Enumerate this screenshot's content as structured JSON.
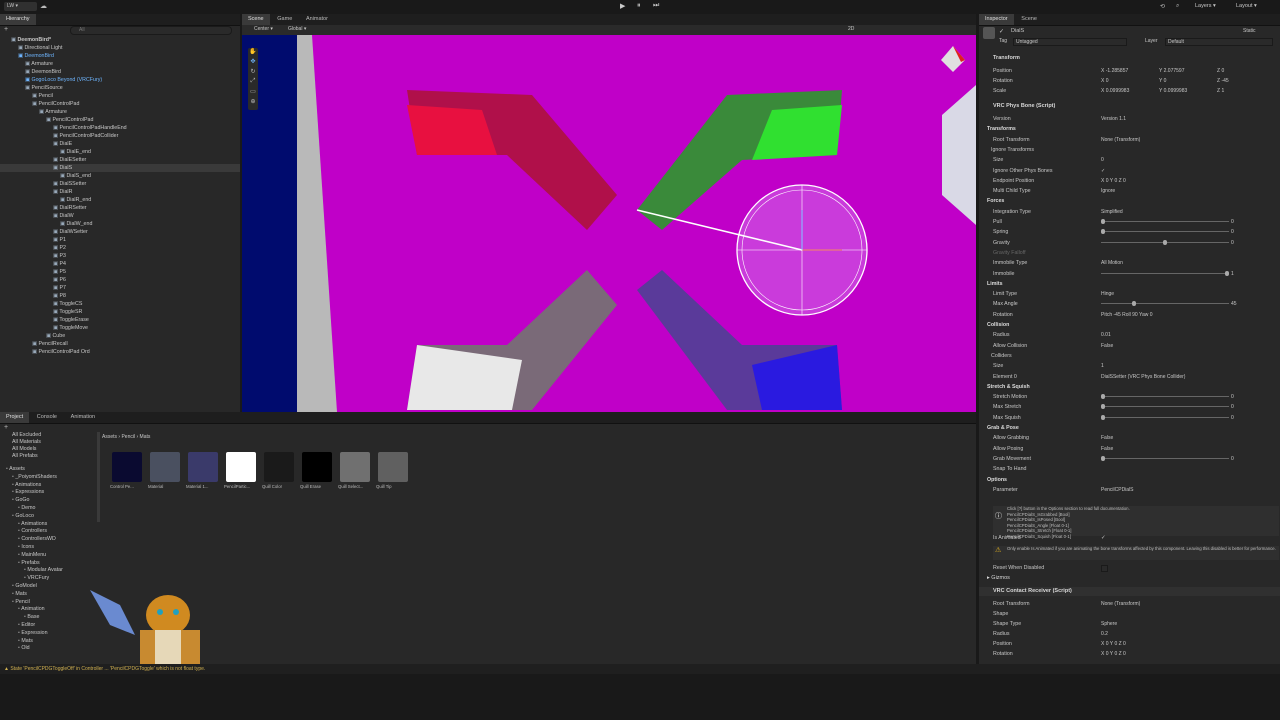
{
  "toolbar": {
    "account": "LW",
    "right_labels": [
      "Layers",
      "Layout"
    ],
    "play": "▶",
    "pause": "⏸",
    "step": "⏭"
  },
  "hierarchy": {
    "tab": "Hierarchy",
    "search_placeholder": "All",
    "items": [
      {
        "label": "DeemonBird*",
        "depth": 1,
        "style": "bold"
      },
      {
        "label": "Directional Light",
        "depth": 2,
        "style": "normal"
      },
      {
        "label": "DeemonBird",
        "depth": 2,
        "style": "blue"
      },
      {
        "label": "Armature",
        "depth": 3,
        "style": "normal"
      },
      {
        "label": "DeemonBird",
        "depth": 3,
        "style": "normal"
      },
      {
        "label": "GogoLoco Beyond (VRCFury)",
        "depth": 3,
        "style": "blue"
      },
      {
        "label": "PencilSource",
        "depth": 3,
        "style": "normal"
      },
      {
        "label": "Pencil",
        "depth": 4,
        "style": "normal"
      },
      {
        "label": "PencilControlPad",
        "depth": 4,
        "style": "normal"
      },
      {
        "label": "Armature",
        "depth": 5,
        "style": "normal"
      },
      {
        "label": "PencilControlPad",
        "depth": 6,
        "style": "normal"
      },
      {
        "label": "PencilControlPadHandleEnd",
        "depth": 7,
        "style": "normal"
      },
      {
        "label": "PencilControlPadCollider",
        "depth": 7,
        "style": "normal"
      },
      {
        "label": "DialE",
        "depth": 7,
        "style": "normal"
      },
      {
        "label": "DialE_end",
        "depth": 8,
        "style": "normal"
      },
      {
        "label": "DialESetter",
        "depth": 7,
        "style": "normal"
      },
      {
        "label": "DialS",
        "depth": 7,
        "style": "selected"
      },
      {
        "label": "DialS_end",
        "depth": 8,
        "style": "normal"
      },
      {
        "label": "DialSSetter",
        "depth": 7,
        "style": "normal"
      },
      {
        "label": "DialR",
        "depth": 7,
        "style": "normal"
      },
      {
        "label": "DialR_end",
        "depth": 8,
        "style": "normal"
      },
      {
        "label": "DialRSetter",
        "depth": 7,
        "style": "normal"
      },
      {
        "label": "DialW",
        "depth": 7,
        "style": "normal"
      },
      {
        "label": "DialW_end",
        "depth": 8,
        "style": "normal"
      },
      {
        "label": "DialWSetter",
        "depth": 7,
        "style": "normal"
      },
      {
        "label": "P1",
        "depth": 7,
        "style": "normal"
      },
      {
        "label": "P2",
        "depth": 7,
        "style": "normal"
      },
      {
        "label": "P3",
        "depth": 7,
        "style": "normal"
      },
      {
        "label": "P4",
        "depth": 7,
        "style": "normal"
      },
      {
        "label": "P5",
        "depth": 7,
        "style": "normal"
      },
      {
        "label": "P6",
        "depth": 7,
        "style": "normal"
      },
      {
        "label": "P7",
        "depth": 7,
        "style": "normal"
      },
      {
        "label": "P8",
        "depth": 7,
        "style": "normal"
      },
      {
        "label": "ToggleCS",
        "depth": 7,
        "style": "normal"
      },
      {
        "label": "ToggleSR",
        "depth": 7,
        "style": "normal"
      },
      {
        "label": "ToggleErase",
        "depth": 7,
        "style": "normal"
      },
      {
        "label": "ToggleMove",
        "depth": 7,
        "style": "normal"
      },
      {
        "label": "Cube",
        "depth": 6,
        "style": "normal"
      },
      {
        "label": "PencilRecall",
        "depth": 4,
        "style": "normal"
      },
      {
        "label": "PencilControlPad Ord",
        "depth": 4,
        "style": "normal"
      }
    ]
  },
  "scene": {
    "tabs": [
      "Scene",
      "Game",
      "Animator"
    ],
    "pivot": "Center",
    "space": "Global",
    "mode_2d": "2D"
  },
  "project": {
    "tabs": [
      "Project",
      "Console",
      "Animation"
    ],
    "breadcrumb": [
      "Assets",
      "Pencil",
      "Mats"
    ],
    "favorites": [
      "All Excluded",
      "All Materials",
      "All Models",
      "All Prefabs"
    ],
    "tree": [
      {
        "label": "Assets",
        "depth": 0
      },
      {
        "label": "_PoiyomiShaders",
        "depth": 1
      },
      {
        "label": "Animations",
        "depth": 1
      },
      {
        "label": "Expressions",
        "depth": 1
      },
      {
        "label": "GoGo",
        "depth": 1
      },
      {
        "label": "Demo",
        "depth": 2
      },
      {
        "label": "GoLoco",
        "depth": 1
      },
      {
        "label": "Animations",
        "depth": 2
      },
      {
        "label": "Controllers",
        "depth": 2
      },
      {
        "label": "ControllersWD",
        "depth": 2
      },
      {
        "label": "Icons",
        "depth": 2
      },
      {
        "label": "MainMenu",
        "depth": 2
      },
      {
        "label": "Prefabs",
        "depth": 2
      },
      {
        "label": "Modular Avatar",
        "depth": 3
      },
      {
        "label": "VRCFury",
        "depth": 3
      },
      {
        "label": "GoModel",
        "depth": 1
      },
      {
        "label": "Mats",
        "depth": 1
      },
      {
        "label": "Pencil",
        "depth": 1
      },
      {
        "label": "Animation",
        "depth": 2
      },
      {
        "label": "Base",
        "depth": 3
      },
      {
        "label": "Editor",
        "depth": 2
      },
      {
        "label": "Expression",
        "depth": 2
      },
      {
        "label": "Mats",
        "depth": 2
      },
      {
        "label": "Old",
        "depth": 2
      }
    ],
    "assets": [
      {
        "label": "Control Pe...",
        "color": "#0a0a30"
      },
      {
        "label": "Material",
        "color": "#4a5060"
      },
      {
        "label": "Material 1...",
        "color": "#3a3a6a"
      },
      {
        "label": "PencilPartic...",
        "color": "#ffffff"
      },
      {
        "label": "Quill Color",
        "color": "#1a1a1a"
      },
      {
        "label": "Quill Erase",
        "color": "#000000"
      },
      {
        "label": "Quill Select...",
        "color": "#707070"
      },
      {
        "label": "Quill Tip",
        "color": "#606060"
      }
    ]
  },
  "status_bar": "▲ State 'PencilCPDGToggleOff' in Controller ... 'PencilCPDGToggle' which is not float type.",
  "inspector": {
    "tabs": [
      "Inspector",
      "Scene"
    ],
    "object_name": "DialS",
    "static_label": "Static",
    "tag_label": "Tag",
    "tag_value": "Untagged",
    "layer_label": "Layer",
    "layer_value": "Default",
    "transform": {
      "title": "Transform",
      "position": {
        "label": "Position",
        "x": "-1.285857",
        "y": "2.077597",
        "z": "0"
      },
      "rotation": {
        "label": "Rotation",
        "x": "0",
        "y": "0",
        "z": "-45"
      },
      "scale": {
        "label": "Scale",
        "x": "0.0999983",
        "y": "0.0999983",
        "z": "1"
      }
    },
    "physbone": {
      "title": "VRC Phys Bone (Script)",
      "rows": [
        {
          "label": "Version",
          "value": "Version 1.1",
          "kind": "dropdown"
        },
        {
          "label": "Transforms",
          "value": "",
          "kind": "section"
        },
        {
          "label": "Root Transform",
          "value": "None (Transform)",
          "kind": "field"
        },
        {
          "label": "Ignore Transforms",
          "value": "",
          "kind": "sub"
        },
        {
          "label": "Size",
          "value": "0",
          "kind": "field"
        },
        {
          "label": "Ignore Other Phys Bones",
          "value": "✓",
          "kind": "check"
        },
        {
          "label": "Endpoint Position",
          "value": "X 0    Y 0    Z 0",
          "kind": "field"
        },
        {
          "label": "Multi Child Type",
          "value": "Ignore",
          "kind": "dropdown"
        },
        {
          "label": "Forces",
          "value": "",
          "kind": "section"
        },
        {
          "label": "Integration Type",
          "value": "Simplified",
          "kind": "dropdown"
        },
        {
          "label": "Pull",
          "value": "0",
          "kind": "slider",
          "level": 0.0
        },
        {
          "label": "Spring",
          "value": "0",
          "kind": "slider",
          "level": 0.0
        },
        {
          "label": "Gravity",
          "value": "0",
          "kind": "slider",
          "level": 0.5
        },
        {
          "label": "Gravity Falloff",
          "value": "",
          "kind": "dim"
        },
        {
          "label": "Immobile Type",
          "value": "All Motion",
          "kind": "dropdown"
        },
        {
          "label": "Immobile",
          "value": "1",
          "kind": "slider",
          "level": 1.0
        },
        {
          "label": "Limits",
          "value": "",
          "kind": "section"
        },
        {
          "label": "Limit Type",
          "value": "Hinge",
          "kind": "dropdown"
        },
        {
          "label": "Max Angle",
          "value": "45",
          "kind": "slider",
          "level": 0.25
        },
        {
          "label": "Rotation",
          "value": "Pitch -45    Roll 90    Yaw 0",
          "kind": "field"
        },
        {
          "label": "Collision",
          "value": "",
          "kind": "section"
        },
        {
          "label": "Radius",
          "value": "0.01",
          "kind": "field"
        },
        {
          "label": "Allow Collision",
          "value": "False",
          "kind": "dropdown"
        },
        {
          "label": "Colliders",
          "value": "",
          "kind": "sub"
        },
        {
          "label": "Size",
          "value": "1",
          "kind": "field"
        },
        {
          "label": "Element 0",
          "value": "DialSSetter (VRC Phys Bone Collider)",
          "kind": "field"
        },
        {
          "label": "Stretch & Squish",
          "value": "",
          "kind": "section"
        },
        {
          "label": "Stretch Motion",
          "value": "0",
          "kind": "slider",
          "level": 0.0
        },
        {
          "label": "Max Stretch",
          "value": "0",
          "kind": "slider",
          "level": 0.0
        },
        {
          "label": "Max Squish",
          "value": "0",
          "kind": "slider",
          "level": 0.0
        },
        {
          "label": "Grab & Pose",
          "value": "",
          "kind": "section"
        },
        {
          "label": "Allow Grabbing",
          "value": "False",
          "kind": "dropdown"
        },
        {
          "label": "Allow Posing",
          "value": "False",
          "kind": "dropdown"
        },
        {
          "label": "Grab Movement",
          "value": "0",
          "kind": "slider",
          "level": 0.0
        },
        {
          "label": "Snap To Hand",
          "value": "",
          "kind": "check"
        },
        {
          "label": "Options",
          "value": "",
          "kind": "section"
        },
        {
          "label": "Parameter",
          "value": "PencilCPDialS",
          "kind": "field"
        }
      ],
      "info": "Click [?] button in the Options section to read full documentation.\nPencilCPDialS_IsGrabbed [Bool]\nPencilCPDialS_IsPosed [Bool]\nPencilCPDialS_Angle [Float 0-1]\nPencilCPDialS_Stretch [Float 0-1]\nPencilCPDialS_Squish [Float 0-1]",
      "is_animated_label": "Is Animated",
      "warning": "Only enable Is Animated if you are animating the bone transforms affected by this component. Leaving this disabled is better for performance.",
      "reset_label": "Reset When Disabled",
      "gizmos_label": "Gizmos"
    },
    "contact": {
      "title": "VRC Contact Receiver (Script)",
      "rows": [
        {
          "label": "Root Transform",
          "value": "None (Transform)"
        },
        {
          "label": "Shape",
          "value": ""
        },
        {
          "label": "Shape Type",
          "value": "Sphere"
        },
        {
          "label": "Radius",
          "value": "0.2"
        },
        {
          "label": "Position",
          "value": "X 0    Y 0    Z 0"
        },
        {
          "label": "Rotation",
          "value": "X 0    Y 0    Z 0"
        }
      ]
    }
  },
  "colors": {
    "magenta": "#c000c8",
    "blue_dark": "#000a6a",
    "accent": "#2c5d87"
  }
}
